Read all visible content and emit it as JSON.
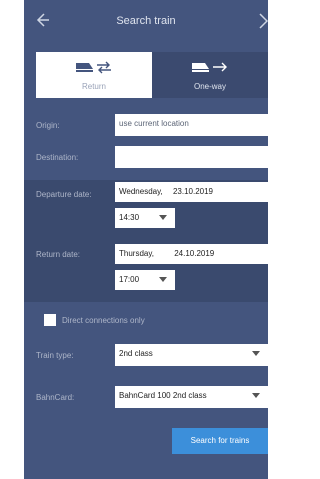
{
  "header": {
    "title": "Search train"
  },
  "tabs": [
    {
      "label": "Return",
      "selected": true
    },
    {
      "label": "One-way",
      "selected": false
    }
  ],
  "origin": {
    "label": "Origin:",
    "value": "use current location"
  },
  "destination": {
    "label": "Destination:",
    "value": ""
  },
  "departure": {
    "label": "Departure date:",
    "day": "Wednesday,",
    "date": "23.10.2019",
    "time": "14:30"
  },
  "return": {
    "label": "Return date:",
    "day": "Thursday,",
    "date": "24.10.2019",
    "time": "17:00"
  },
  "direct": {
    "label": "Direct connections only",
    "checked": false
  },
  "train_type": {
    "label": "Train type:",
    "value": "2nd class"
  },
  "bahncard": {
    "label": "BahnCard:",
    "value": "BahnCard 100 2nd class"
  },
  "search_button": {
    "label": "Search for trains"
  },
  "colors": {
    "background": "#44557e",
    "panel": "#3a4a6e",
    "accent": "#3c8fda"
  }
}
